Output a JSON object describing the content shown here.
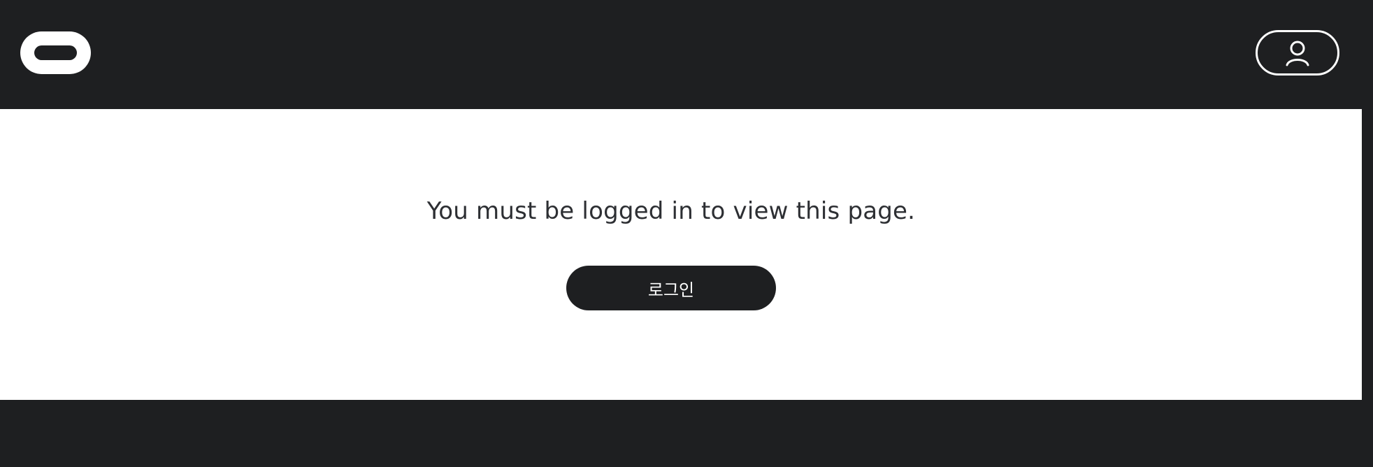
{
  "header": {
    "logo_icon": "vr-headset-logo-icon",
    "account_icon": "user-profile-icon"
  },
  "main": {
    "message": "You must be logged in to view this page.",
    "login_label": "로그인"
  },
  "colors": {
    "background_dark": "#1e1f21",
    "content_background": "#ffffff",
    "text": "#2d2f33",
    "button_text": "#ffffff"
  }
}
